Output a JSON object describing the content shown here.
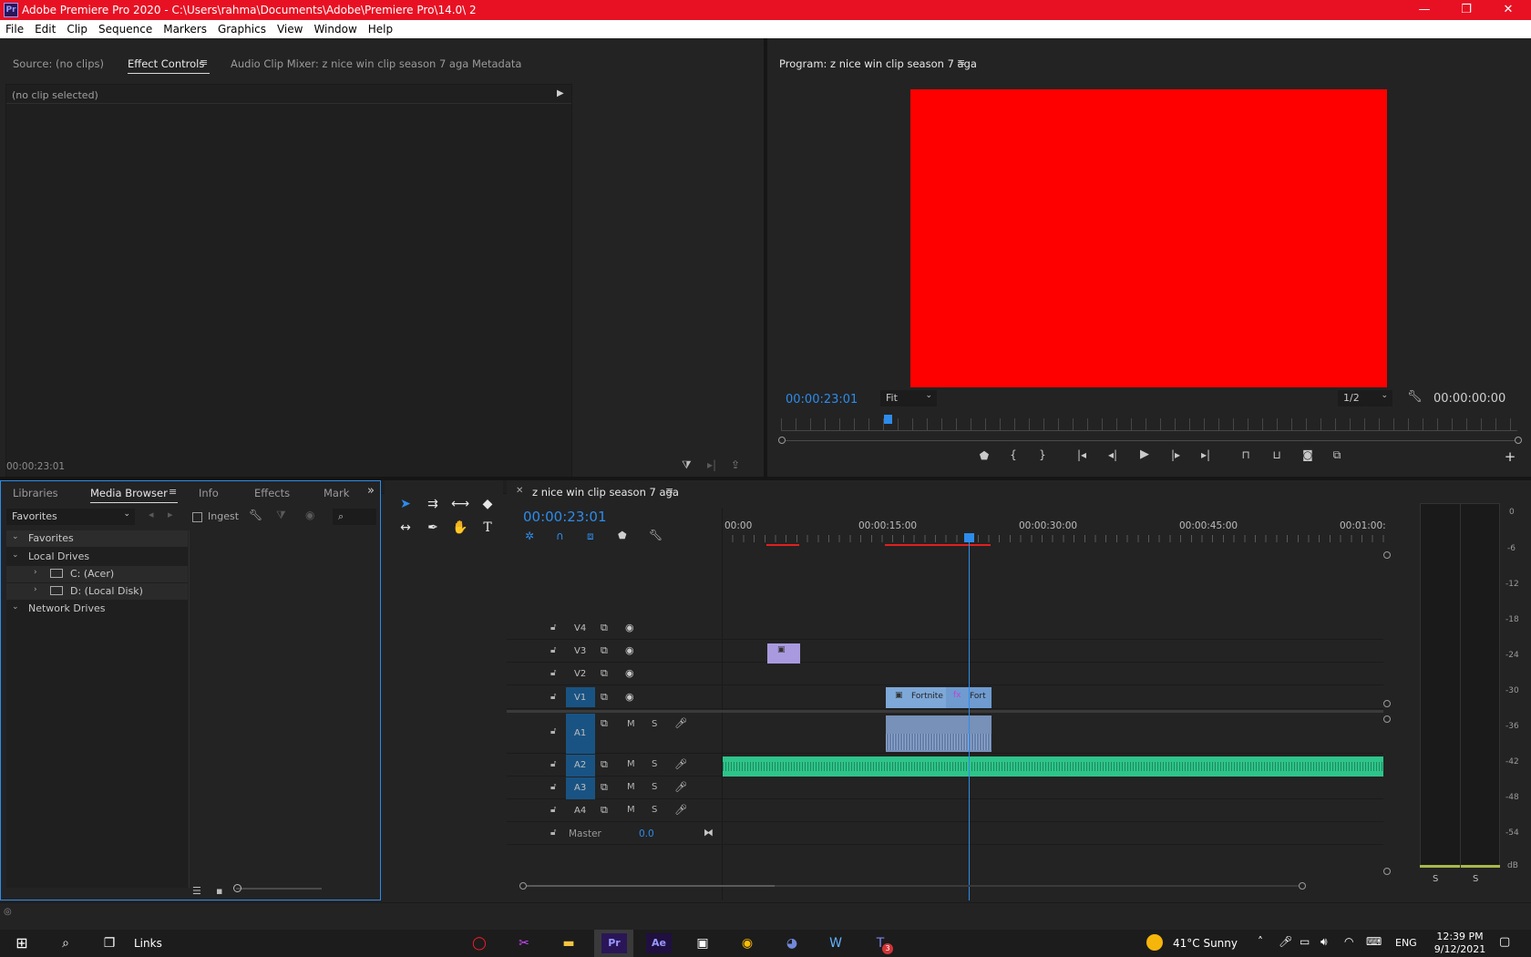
{
  "window": {
    "app_icon": "Pr",
    "title": "Adobe Premiere Pro 2020 - C:\\Users\\rahma\\Documents\\Adobe\\Premiere Pro\\14.0\\ 2",
    "minimize": "—",
    "restore": "❐",
    "close": "✕"
  },
  "menu": [
    "File",
    "Edit",
    "Clip",
    "Sequence",
    "Markers",
    "Graphics",
    "View",
    "Window",
    "Help"
  ],
  "source_panel": {
    "tabs": [
      "Source: (no clips)",
      "Effect Controls",
      "Audio Clip Mixer: z nice win clip season 7 aga",
      "Metadata"
    ],
    "active_tab": "Effect Controls",
    "no_clip_label": "(no clip selected)",
    "timecode": "00:00:23:01"
  },
  "program_monitor": {
    "title": "Program: z nice win clip season 7 aga",
    "screen_color": "#ff0000",
    "timecode": "00:00:23:01",
    "fit_label": "Fit",
    "resolution": "1/2",
    "end_timecode": "00:00:00:00",
    "playhead_fraction": 0.145
  },
  "project_panel": {
    "tabs": [
      "Libraries",
      "Media Browser",
      "Info",
      "Effects",
      "Mark"
    ],
    "active_tab": "Media Browser",
    "favorites_select": "Favorites",
    "ingest_label": "Ingest",
    "tree": [
      {
        "label": "Favorites",
        "level": 0
      },
      {
        "label": "Local Drives",
        "level": 0
      },
      {
        "label": "C: (Acer)",
        "level": 1
      },
      {
        "label": "D: (Local Disk)",
        "level": 1
      },
      {
        "label": "Network Drives",
        "level": 0
      }
    ]
  },
  "timeline": {
    "sequence_name": "z nice win clip season 7 aga",
    "timecode": "00:00:23:01",
    "ruler": [
      "00:00",
      "00:00:15:00",
      "00:00:30:00",
      "00:00:45:00",
      "00:01:00:"
    ],
    "video_tracks": [
      "V4",
      "V3",
      "V2",
      "V1"
    ],
    "audio_tracks": [
      "A1",
      "A2",
      "A3",
      "A4"
    ],
    "master_label": "Master",
    "master_value": "0.0",
    "clip_labels": [
      "Fortnite",
      "Fort"
    ],
    "m_label": "M",
    "s_label": "S"
  },
  "meter": {
    "scale": [
      "0",
      "-6",
      "-12",
      "-18",
      "-24",
      "-30",
      "-36",
      "-42",
      "-48",
      "-54",
      "dB"
    ],
    "solo": [
      "S",
      "S"
    ]
  },
  "taskbar": {
    "search_label": "Links",
    "weather": "41°C  Sunny",
    "lang": "ENG",
    "time": "12:39 PM",
    "date": "9/12/2021",
    "badge": "3"
  }
}
